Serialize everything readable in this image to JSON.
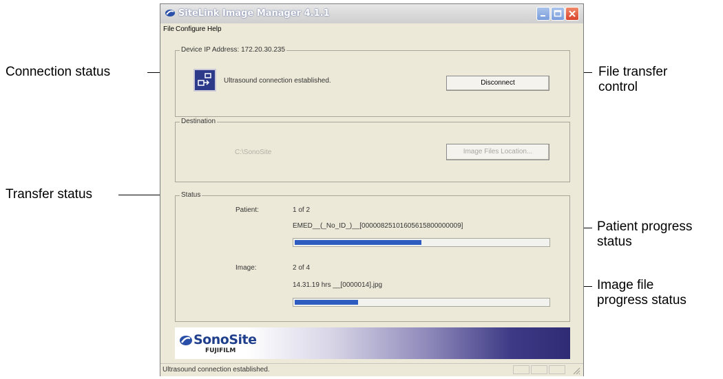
{
  "annotations": {
    "connection_status": "Connection status",
    "file_transfer_control_line1": "File transfer",
    "file_transfer_control_line2": "control",
    "transfer_status": "Transfer status",
    "patient_progress_line1": "Patient progress",
    "patient_progress_line2": "status",
    "image_progress_line1": "Image file",
    "image_progress_line2": "progress status"
  },
  "window": {
    "title": "SiteLink Image Manager 4.1.1"
  },
  "menu": [
    {
      "label": "File"
    },
    {
      "label": "Configure"
    },
    {
      "label": "Help"
    }
  ],
  "device": {
    "group_label": "Device IP Address: 172.20.30.235",
    "connection_message": "Ultrasound connection established.",
    "disconnect_label": "Disconnect"
  },
  "destination": {
    "group_label": "Destination",
    "path": "C:\\SonoSite",
    "location_button": "Image Files Location..."
  },
  "status": {
    "group_label": "Status",
    "patient_label": "Patient:",
    "patient_count": "1 of 2",
    "patient_file": "EMED__(_No_ID_)__[00000825101605615800000009]",
    "patient_progress": 0.5,
    "image_label": "Image:",
    "image_count": "2 of 4",
    "image_file": "14.31.19 hrs __[0000014].jpg",
    "image_progress": 0.25
  },
  "banner": {
    "brand": "SonoSite",
    "sub_brand": "FUJIFILM"
  },
  "statusbar": {
    "text": "Ultrasound connection established."
  },
  "colors": {
    "progress_fill": "#2e5bbf",
    "window_bg": "#ece9d8",
    "banner_dark": "#2f2c74"
  }
}
